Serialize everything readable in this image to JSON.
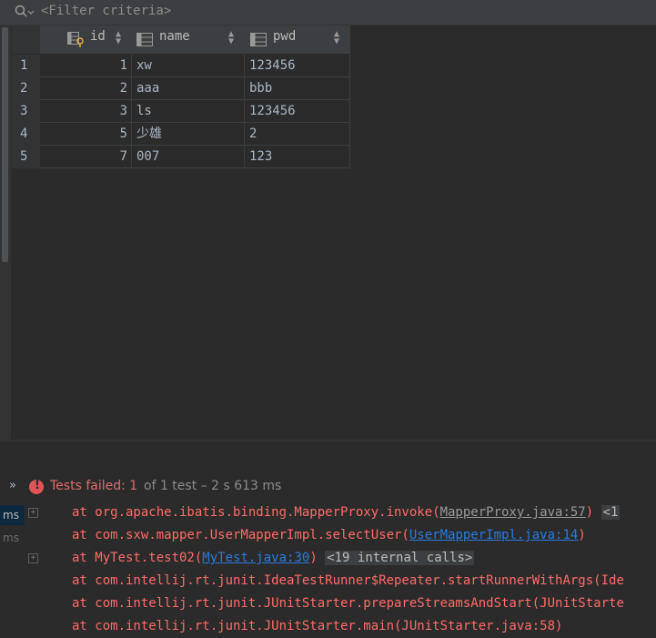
{
  "filter": {
    "placeholder": "<Filter criteria>"
  },
  "table": {
    "columns": [
      {
        "label": "id",
        "icon": "primary-key-column-icon"
      },
      {
        "label": "name",
        "icon": "column-icon"
      },
      {
        "label": "pwd",
        "icon": "column-icon"
      }
    ],
    "rows": [
      {
        "n": "1",
        "id": "1",
        "name": "xw",
        "pwd": "123456"
      },
      {
        "n": "2",
        "id": "2",
        "name": "aaa",
        "pwd": "bbb"
      },
      {
        "n": "3",
        "id": "3",
        "name": "ls",
        "pwd": "123456"
      },
      {
        "n": "4",
        "id": "5",
        "name": "少雄",
        "pwd": "2"
      },
      {
        "n": "5",
        "id": "7",
        "name": "007",
        "pwd": "123"
      }
    ]
  },
  "status": {
    "chevron": "»",
    "failed_label": "Tests failed:",
    "failed_count": "1",
    "rest": "of 1 test – 2 s 613 ms"
  },
  "side": {
    "ms1": "ms",
    "ms2": "ms"
  },
  "trace": {
    "l1_pre": "at org.apache.ibatis.binding.MapperProxy.invoke(",
    "l1_link": "MapperProxy.java:57",
    "l1_post": ")",
    "l1_tail": "<1",
    "l2_pre": "at com.sxw.mapper.UserMapperImpl.selectUser(",
    "l2_link": "UserMapperImpl.java:14",
    "l2_post": ")",
    "l3_pre": "at MyTest.test02(",
    "l3_link": "MyTest.java:30",
    "l3_post": ")",
    "l3_internal": "<19 internal calls>",
    "l4": "at com.intellij.rt.junit.IdeaTestRunner$Repeater.startRunnerWithArgs(Ide",
    "l5": "at com.intellij.rt.junit.JUnitStarter.prepareStreamsAndStart(JUnitStarte",
    "l6": "at com.intellij.rt.junit.JUnitStarter.main(JUnitStarter.java:58)"
  }
}
